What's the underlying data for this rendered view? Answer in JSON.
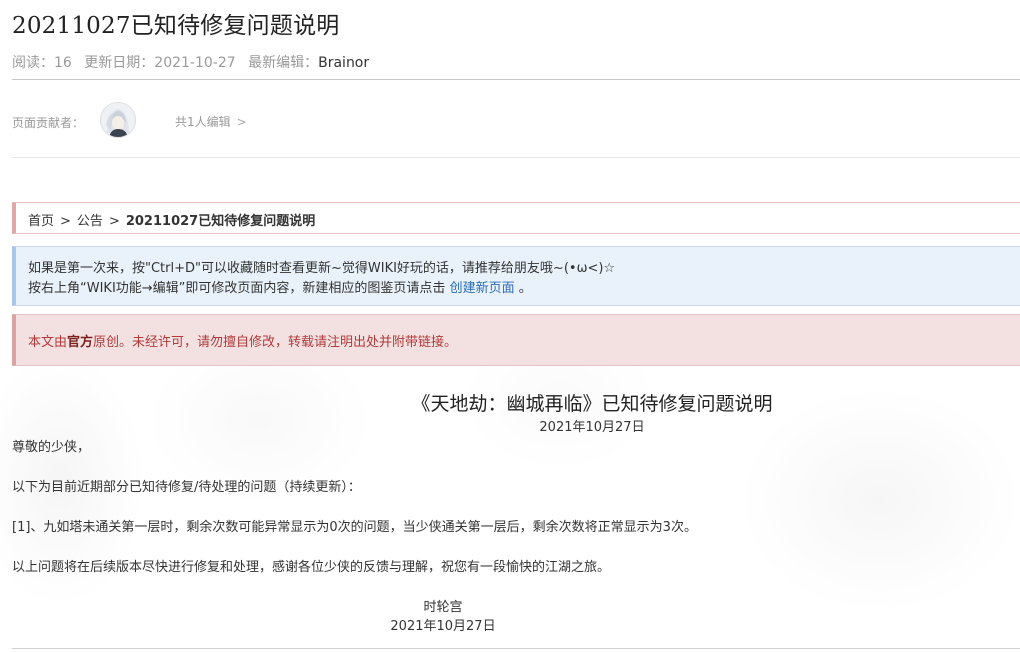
{
  "page": {
    "title": "20211027已知待修复问题说明",
    "meta": {
      "reads_label": "阅读：",
      "reads": "16",
      "updated_label": "更新日期：",
      "updated": "2021-10-27",
      "editor_label": "最新编辑：",
      "editor": "Brainor"
    }
  },
  "contributors": {
    "label": "页面贡献者：",
    "count_text": "共1人编辑",
    "chevron": ">"
  },
  "breadcrumb": {
    "home": "首页",
    "category": "公告",
    "current": "20211027已知待修复问题说明",
    "sep": ">"
  },
  "notice_info": {
    "line1": "如果是第一次来，按\"Ctrl+D\"可以收藏随时查看更新~觉得WIKI好玩的话，请推荐给朋友哦~(•ω<)☆",
    "line2_prefix": "按右上角“WIKI功能→编辑”即可修改页面内容，新建相应的图鉴页请点击",
    "line2_link": "创建新页面",
    "line2_suffix": "。"
  },
  "notice_copyright": {
    "prefix": "本文由",
    "bold": "官方",
    "suffix": "原创。未经许可，请勿擅自修改，转载请注明出处并附带链接。"
  },
  "article": {
    "heading": "《天地劫：幽城再临》已知待修复问题说明",
    "date": "2021年10月27日",
    "greeting": "尊敬的少侠，",
    "intro": "以下为目前近期部分已知待修复/待处理的问题（持续更新）：",
    "item1": "[1]、九如塔未通关第一层时，剩余次数可能异常显示为0次的问题，当少侠通关第一层后，剩余次数将正常显示为3次。",
    "closing": "以上问题将在后续版本尽快进行修复和处理，感谢各位少侠的反馈与理解，祝您有一段愉快的江湖之旅。",
    "signature": "时轮宫",
    "sign_date": "2021年10月27日"
  },
  "colors": {
    "link": "#2a6db5",
    "notice_info_bg": "#e9f2fb",
    "notice_warn_bg": "#f3e1e1",
    "notice_warn_text": "#b03b3b"
  }
}
